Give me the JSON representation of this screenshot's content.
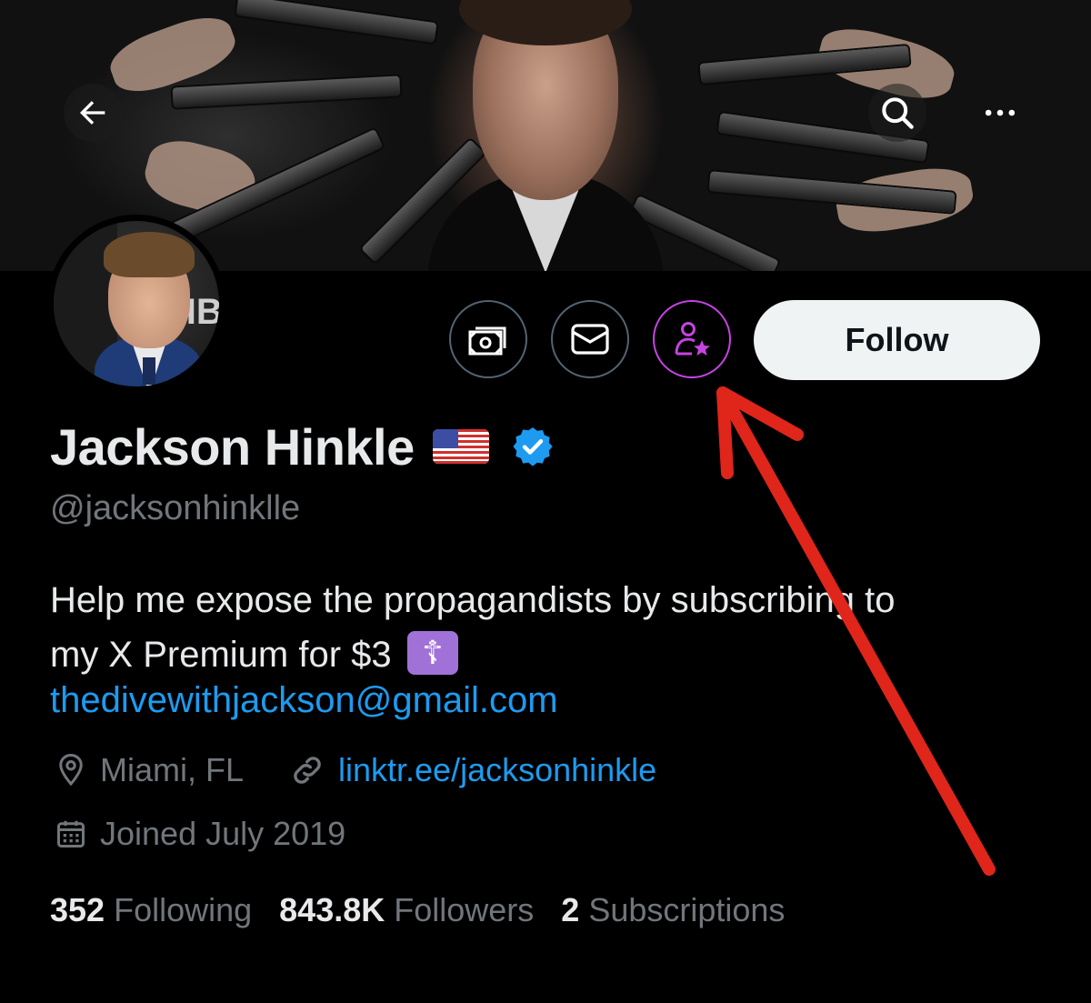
{
  "header": {
    "back_icon": "arrow-left-icon",
    "search_icon": "search-icon",
    "more_icon": "more-horizontal-icon"
  },
  "profile": {
    "name": "Jackson Hinkle",
    "flag_emoji": "🇺🇸",
    "handle": "@jacksonhinklle",
    "bio_line1": "Help me expose the propagandists by subscribing to",
    "bio_line2": "my X Premium for $3",
    "bio_emoji": "☦",
    "email": "thedivewithjackson@gmail.com",
    "location": "Miami, FL",
    "website": "linktr.ee/jacksonhinkle",
    "joined": "Joined July 2019",
    "avatar_text": "HB"
  },
  "actions": {
    "follow_label": "Follow",
    "icons": [
      "money-icon",
      "message-icon",
      "subscribe-icon"
    ]
  },
  "stats": {
    "following_count": "352",
    "following_label": "Following",
    "followers_count": "843.8K",
    "followers_label": "Followers",
    "subscriptions_count": "2",
    "subscriptions_label": "Subscriptions"
  },
  "colors": {
    "background": "#000000",
    "primary_text": "#e7e9ea",
    "secondary_text": "#71767b",
    "link": "#1d9bf0",
    "subscribe_accent": "#c643e3",
    "annotation_arrow": "#e0251b"
  }
}
